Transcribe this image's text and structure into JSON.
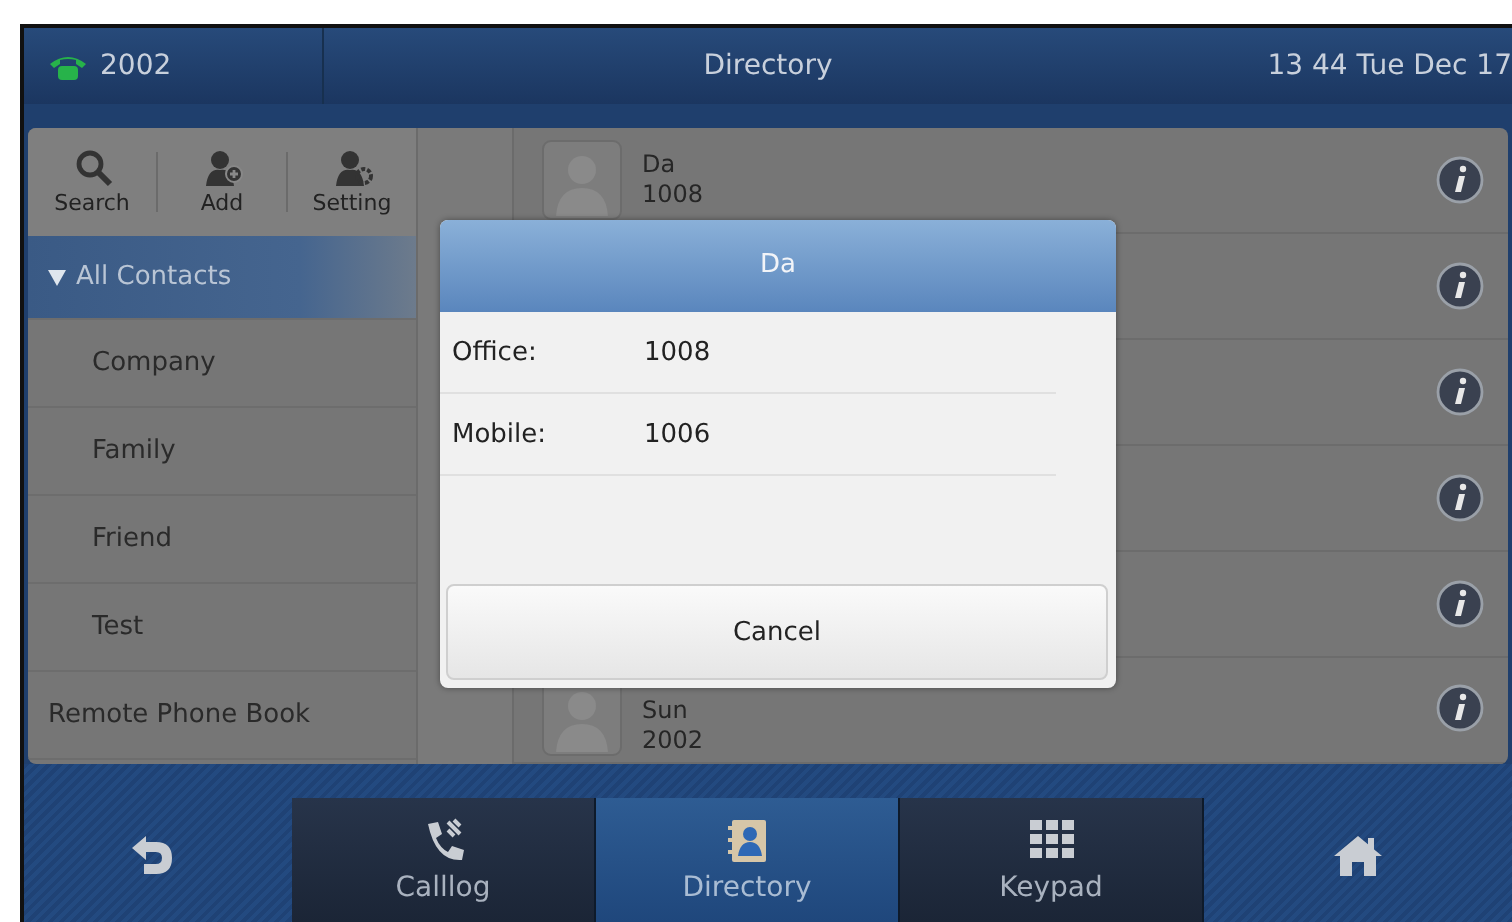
{
  "status_bar": {
    "line": "2002",
    "title": "Directory",
    "clock": "13 44 Tue Dec 17"
  },
  "toolbar": [
    {
      "kind": "search",
      "label": "Search"
    },
    {
      "kind": "add",
      "label": "Add"
    },
    {
      "kind": "setting",
      "label": "Setting"
    }
  ],
  "sidebar": {
    "items": [
      {
        "label": "All Contacts",
        "selected": true,
        "expanded": true,
        "children": [
          {
            "label": "Company",
            "selected": false
          },
          {
            "label": "Family",
            "selected": false
          },
          {
            "label": "Friend",
            "selected": false
          },
          {
            "label": "Test",
            "selected": false
          }
        ]
      },
      {
        "label": "Remote Phone Book",
        "selected": false,
        "expanded": false
      }
    ]
  },
  "contacts": [
    {
      "kind": "contact",
      "name": "Da",
      "number": "1008"
    },
    {
      "kind": "covered"
    },
    {
      "kind": "covered"
    },
    {
      "kind": "covered"
    },
    {
      "kind": "covered"
    },
    {
      "kind": "contact",
      "name": "Sun",
      "number": "2002"
    }
  ],
  "dialog": {
    "title": "Da",
    "fields": [
      {
        "label": "Office:",
        "value": "1008"
      },
      {
        "label": "Mobile:",
        "value": "1006"
      }
    ],
    "button": "Cancel"
  },
  "nav": {
    "tabs": [
      {
        "kind": "calllog",
        "label": "Calllog",
        "selected": false
      },
      {
        "kind": "directory",
        "label": "Directory",
        "selected": true
      },
      {
        "kind": "keypad",
        "label": "Keypad",
        "selected": false
      }
    ]
  }
}
